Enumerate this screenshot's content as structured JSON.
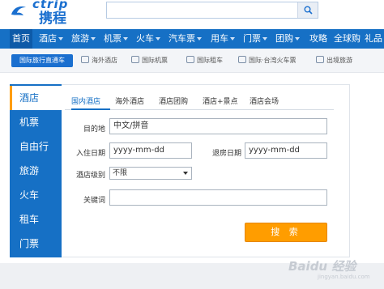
{
  "header": {
    "logo_en": "ctrip",
    "logo_cn": "携程",
    "search_placeholder": ""
  },
  "nav": [
    {
      "label": "首页",
      "caret": false,
      "active": true
    },
    {
      "label": "酒店",
      "caret": true
    },
    {
      "label": "旅游",
      "caret": true
    },
    {
      "label": "机票",
      "caret": true
    },
    {
      "label": "火车",
      "caret": true
    },
    {
      "label": "汽车票",
      "caret": true
    },
    {
      "label": "用车",
      "caret": true
    },
    {
      "label": "门票",
      "caret": true
    },
    {
      "label": "团购",
      "caret": true
    },
    {
      "label": "攻略",
      "caret": false
    },
    {
      "label": "全球购",
      "caret": false
    },
    {
      "label": "礼品",
      "caret": false
    }
  ],
  "subnav": {
    "badge": "国际旅行直通车",
    "links": [
      "海外酒店",
      "国际机票",
      "国际租车",
      "国际·台湾火车票",
      "出境旅游"
    ]
  },
  "sidebar": {
    "items": [
      "酒店",
      "机票",
      "自由行",
      "旅游",
      "火车",
      "租车",
      "门票"
    ],
    "active_index": 0
  },
  "panel": {
    "tabs": [
      "国内酒店",
      "海外酒店",
      "酒店团购",
      "酒店+景点",
      "酒店会场"
    ],
    "active_tab": 0,
    "destination": {
      "label": "目的地",
      "value": "中文/拼音"
    },
    "checkin": {
      "label": "入住日期",
      "value": "yyyy-mm-dd"
    },
    "checkout": {
      "label": "退房日期",
      "value": "yyyy-mm-dd"
    },
    "hotel_level": {
      "label": "酒店级别",
      "value": "不限"
    },
    "keyword": {
      "label": "关键词",
      "value": ""
    },
    "search_button": "搜 索"
  },
  "watermark": {
    "text": "Baidu 经验",
    "sub": "jingyan.baidu.com"
  },
  "colors": {
    "brand_blue": "#1670c5",
    "accent_orange": "#ff9d00"
  }
}
